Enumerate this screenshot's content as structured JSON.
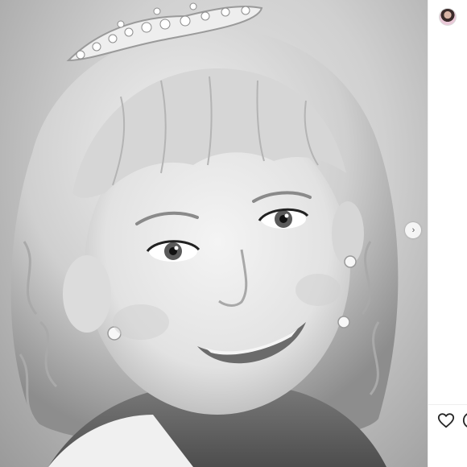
{
  "post": {
    "media": {
      "icon": "photo-portrait",
      "next_icon": "chevron-right-icon"
    },
    "author": {
      "avatar_icon": "profile-avatar"
    },
    "actions": {
      "like_icon": "heart-icon",
      "comment_icon": "comment-icon"
    },
    "next_glyph": "›"
  },
  "colors": {
    "panel_background": "#ffffff",
    "divider": "#efefef",
    "icon_stroke": "#262626"
  }
}
